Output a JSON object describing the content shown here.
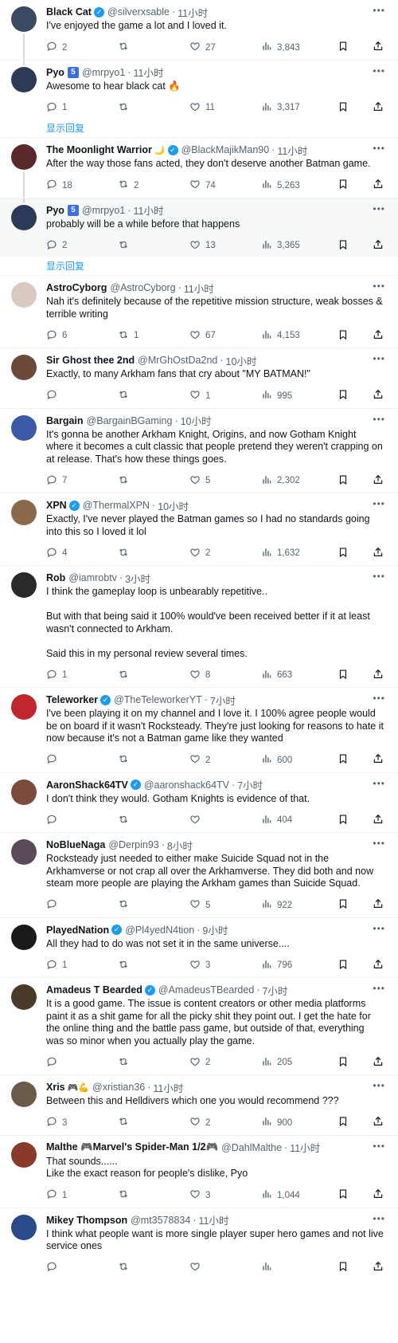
{
  "show_replies_label": "显示回复",
  "tweets": [
    {
      "name": "Black Cat",
      "verified": true,
      "handle": "@silverxsable",
      "time": "11小时",
      "text": "I've enjoyed the game a lot and I loved it.",
      "replies": "2",
      "retweets": "",
      "likes": "27",
      "views": "3,843",
      "avatar_color": "#3b4a63"
    },
    {
      "name": "Pyo",
      "badge": "5",
      "handle": "@mrpyo1",
      "time": "11小时",
      "text": "Awesome to hear black cat 🔥",
      "replies": "1",
      "retweets": "",
      "likes": "11",
      "views": "3,317",
      "avatar_color": "#2b3a57"
    },
    {
      "name": "The Moonlight Warrior",
      "emoji": "🌙",
      "verified": true,
      "handle": "@BlackMajikMan90",
      "time": "11小时",
      "text": "After the way those fans acted, they don't deserve another Batman game.",
      "replies": "18",
      "retweets": "2",
      "likes": "74",
      "views": "5,263",
      "avatar_color": "#5a2a2a"
    },
    {
      "name": "Pyo",
      "badge": "5",
      "handle": "@mrpyo1",
      "time": "11小时",
      "text": "probably will be a while before that happens",
      "replies": "2",
      "retweets": "",
      "likes": "13",
      "views": "3,365",
      "avatar_color": "#2b3a57"
    },
    {
      "name": "AstroCyborg",
      "handle": "@AstroCyborg",
      "time": "11小时",
      "text": "Nah it's definitely because of the repetitive mission structure, weak bosses & terrible writing",
      "replies": "6",
      "retweets": "1",
      "likes": "67",
      "views": "4,153",
      "avatar_color": "#d9c9c0"
    },
    {
      "name": "Sir Ghost thee 2nd",
      "handle": "@MrGhOstDa2nd",
      "time": "10小时",
      "text": "Exactly, to many Arkham fans that cry about \"MY BATMAN!\"",
      "replies": "",
      "retweets": "",
      "likes": "1",
      "views": "995",
      "avatar_color": "#6b4a3a"
    },
    {
      "name": "Bargain",
      "handle": "@BargainBGaming",
      "time": "10小时",
      "text": "It's gonna be another Arkham Knight, Origins, and now Gotham Knight where it becomes a cult classic that people pretend they weren't crapping on at release. That's how these things goes.",
      "replies": "7",
      "retweets": "",
      "likes": "5",
      "views": "2,302",
      "avatar_color": "#3a5aa8"
    },
    {
      "name": "XPN",
      "verified": true,
      "handle": "@ThermalXPN",
      "time": "10小时",
      "text": "Exactly, I've never played the Batman games so I had no standards going into this so I loved it lol",
      "replies": "4",
      "retweets": "",
      "likes": "2",
      "views": "1,632",
      "avatar_color": "#8a6a4a"
    },
    {
      "name": "Rob",
      "handle": "@iamrobtv",
      "time": "3小时",
      "text": "I think the gameplay loop is unbearably repetitive..\n\nBut with that being said it 100% would've been received better if it at least wasn't connected to Arkham.\n\nSaid this in my personal review several times.",
      "replies": "1",
      "retweets": "",
      "likes": "8",
      "views": "663",
      "avatar_color": "#2a2a2a"
    },
    {
      "name": "Teleworker",
      "verified": true,
      "handle": "@TheTeleworkerYT",
      "time": "7小时",
      "text": "I've been playing it on my channel and I love it. I 100% agree people would be on board if it wasn't Rocksteady. They're just looking for reasons to hate it now because it's not a Batman game like they wanted",
      "replies": "",
      "retweets": "",
      "likes": "2",
      "views": "600",
      "avatar_color": "#c0262b"
    },
    {
      "name": "AaronShack64TV",
      "verified": true,
      "handle": "@aaronshack64TV",
      "time": "7小时",
      "text": "I don't think they would. Gotham Knights is evidence of that.",
      "replies": "",
      "retweets": "",
      "likes": "",
      "views": "404",
      "avatar_color": "#7a4a3a"
    },
    {
      "name": "NoBlueNaga",
      "handle": "@Derpin93",
      "time": "8小时",
      "text": "Rocksteady just needed to either make Suicide Squad not in the Arkhamverse or not crap all over the Arkhamverse. They did both and now steam more people are playing the Arkham games than Suicide Squad.",
      "replies": "",
      "retweets": "",
      "likes": "5",
      "views": "922",
      "avatar_color": "#5a4a5a"
    },
    {
      "name": "PlayedNation",
      "verified": true,
      "handle": "@Pl4yedN4tion",
      "time": "9小时",
      "text": "All they had to do was not set it in the same universe....",
      "replies": "1",
      "retweets": "",
      "likes": "3",
      "views": "796",
      "avatar_color": "#1a1a1a"
    },
    {
      "name": "Amadeus T Bearded",
      "verified": true,
      "handle": "@AmadeusTBearded",
      "time": "7小时",
      "text": "It is a good game. The issue is content creators or other media platforms paint it as a shit game for all the picky shit they point out. I get the hate for the online thing and the battle pass game, but outside of that, everything was so minor when you actually play the game.",
      "replies": "",
      "retweets": "",
      "likes": "2",
      "views": "205",
      "avatar_color": "#4a3a2a"
    },
    {
      "name": "Xris",
      "emoji": "🎮💪",
      "handle": "@xristian36",
      "time": "11小时",
      "text": "Between this and Helldivers which one you would recommend ???",
      "replies": "3",
      "retweets": "",
      "likes": "2",
      "views": "900",
      "avatar_color": "#6a5a4a"
    },
    {
      "name": "Malthe 🎮Marvel's Spider-Man 1/2🎮",
      "handle": "@DahlMalthe",
      "time": "11小时",
      "text": "That sounds......\nLike the exact reason for people's dislike, Pyo",
      "replies": "1",
      "retweets": "",
      "likes": "3",
      "views": "1,044",
      "avatar_color": "#8a3a2a"
    },
    {
      "name": "Mikey Thompson",
      "handle": "@mt3578834",
      "time": "11小时",
      "text": "I think what people want is more single player super hero games and not live service ones",
      "replies": "",
      "retweets": "",
      "likes": "",
      "views": "",
      "avatar_color": "#2a4a8a"
    }
  ]
}
